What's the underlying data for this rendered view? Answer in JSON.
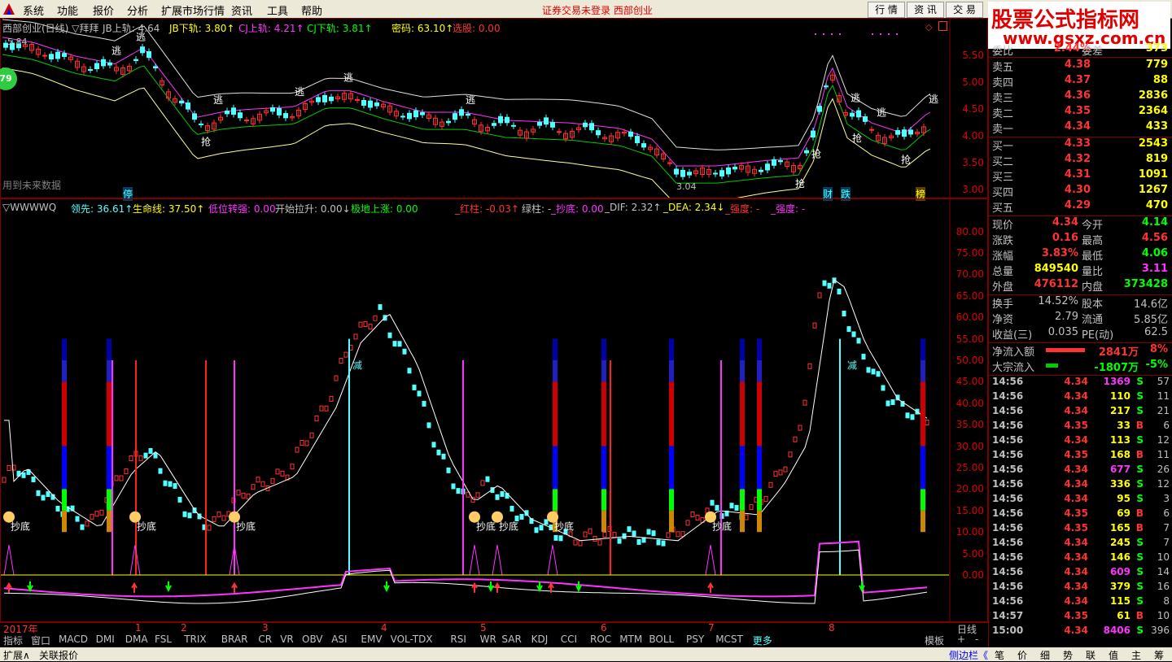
{
  "menu": {
    "items": [
      "系统",
      "功能",
      "报价",
      "分析",
      "扩展市场行情",
      "资讯",
      "工具",
      "帮助"
    ],
    "status": "证券交易未登录  西部创业",
    "buttons": [
      "行 情",
      "资 讯",
      "交 易"
    ]
  },
  "logo": {
    "title": "股票公式指标网",
    "url": "www.gsxz.com.cn"
  },
  "main_chart": {
    "legend": {
      "title": "西部创业(日线) ▽拜拜",
      "jb_up": "JB上轨: 4.64",
      "jb_down": "JB下轨: 3.80↑",
      "cj_up": "CJ上轨: 4.21↑",
      "cj_down": "CJ下轨: 3.81↑",
      "mima": "密码: 63.10↑",
      "xuandu": "选股: 0.00"
    },
    "high_label": "5.84",
    "low_label": "3.04",
    "future_note": "用到未来数据",
    "badge_79": "79",
    "y_ticks": [
      "5.50",
      "5.00",
      "4.50",
      "4.00",
      "3.50",
      "3.00"
    ],
    "markers_escape": "逃",
    "markers_grab": "抢",
    "bottom_marks": [
      "停",
      "财",
      "跌",
      "榜"
    ]
  },
  "sub_chart": {
    "legend": {
      "name": "▽WWWWQ",
      "lingxian": "领先: 36.61↑",
      "shengming": "生命线: 37.50↑",
      "diwei": "低位转强: 0.00",
      "kaishi": "开始拉升: 0.00↓",
      "jidi": "极地上涨: 0.00",
      "hongzhu": "_红柱: -0.03↑",
      "lvzhu": "绿柱: -",
      "chaodi": "_抄底: 0.00",
      "dif": "_DIF: 2.32↑",
      "dea": "_DEA: 2.34↓",
      "qiangdu1": "_强度: -",
      "qiangdu2": "_强度: -"
    },
    "y_ticks": [
      "80.00",
      "75.00",
      "70.00",
      "65.00",
      "60.00",
      "55.00",
      "50.00",
      "45.00",
      "40.00",
      "35.00",
      "30.00",
      "25.00",
      "20.00",
      "15.00",
      "10.00",
      "5.00",
      "0.00"
    ],
    "chaodi_label": "抄底",
    "jian_label": "减"
  },
  "date_axis": {
    "year": "2017年",
    "months": [
      "1",
      "2",
      "3",
      "4",
      "5",
      "6",
      "7",
      "8"
    ],
    "period": "日线"
  },
  "tabs": [
    "指标",
    "窗口",
    "MACD",
    "DMI",
    "DMA",
    "FSL",
    "TRIX",
    "BRAR",
    "CR",
    "VR",
    "OBV",
    "ASI",
    "EMV",
    "VOL-TDX",
    "RSI",
    "WR",
    "SAR",
    "KDJ",
    "CCI",
    "ROC",
    "MTM",
    "BOLL",
    "PSY",
    "MCST",
    "更多"
  ],
  "tab_right": [
    "模板",
    "+",
    "-"
  ],
  "bottom_bar": {
    "left": [
      "扩展∧",
      "关联报价"
    ],
    "right": [
      "侧边栏《",
      "笔",
      "价",
      "细",
      "势",
      "联",
      "值",
      "主",
      "筹"
    ]
  },
  "quote": {
    "top_partial": {
      "name": "委比",
      "value": "2.44%",
      "name2": "委差",
      "value2": "373"
    },
    "sell": [
      {
        "name": "卖五",
        "price": "4.38",
        "vol": "779"
      },
      {
        "name": "卖四",
        "price": "4.37",
        "vol": "88"
      },
      {
        "name": "卖三",
        "price": "4.36",
        "vol": "2836"
      },
      {
        "name": "卖二",
        "price": "4.35",
        "vol": "2364"
      },
      {
        "name": "卖一",
        "price": "4.34",
        "vol": "433"
      }
    ],
    "buy": [
      {
        "name": "买一",
        "price": "4.33",
        "vol": "2543"
      },
      {
        "name": "买二",
        "price": "4.32",
        "vol": "819"
      },
      {
        "name": "买三",
        "price": "4.31",
        "vol": "1091"
      },
      {
        "name": "买四",
        "price": "4.30",
        "vol": "1267"
      },
      {
        "name": "买五",
        "price": "4.29",
        "vol": "470"
      }
    ],
    "stats": [
      {
        "l": "现价",
        "lv": "4.34",
        "r": "今开",
        "rv": "4.14",
        "lc": "#ff3333",
        "rc": "#00ff00"
      },
      {
        "l": "涨跌",
        "lv": "0.16",
        "r": "最高",
        "rv": "4.56",
        "lc": "#ff3333",
        "rc": "#ff3333"
      },
      {
        "l": "涨幅",
        "lv": "3.83%",
        "r": "最低",
        "rv": "4.06",
        "lc": "#ff3333",
        "rc": "#00ff00"
      },
      {
        "l": "总量",
        "lv": "849540",
        "r": "量比",
        "rv": "3.11",
        "lc": "#ffff00",
        "rc": "#ff33ff"
      },
      {
        "l": "外盘",
        "lv": "476112",
        "r": "内盘",
        "rv": "373428",
        "lc": "#ff3333",
        "rc": "#00ff00"
      }
    ],
    "stats2": [
      {
        "l": "换手",
        "lv": "14.52%",
        "r": "股本",
        "rv": "14.6亿"
      },
      {
        "l": "净资",
        "lv": "2.79",
        "r": "流通",
        "rv": "5.85亿"
      },
      {
        "l": "收益(三)",
        "lv": "0.035",
        "r": "PE(动)",
        "rv": "62.5"
      }
    ],
    "flow": [
      {
        "name": "净流入额",
        "bar_fraction": 0.8,
        "bar_color": "#ff3333",
        "value": "2841万",
        "pct": "8%",
        "color": "#ff3333"
      },
      {
        "name": "大宗流入",
        "bar_fraction": 0.25,
        "bar_color": "#00cc00",
        "value": "-1807万",
        "pct": "-5%",
        "color": "#00ff00"
      }
    ],
    "ticks": [
      {
        "t": "14:56",
        "p": "4.34",
        "v": "1369",
        "s": "S",
        "n": "57",
        "pc": "#ff3333",
        "vc": "#ff33ff"
      },
      {
        "t": "14:56",
        "p": "4.34",
        "v": "110",
        "s": "S",
        "n": "11",
        "pc": "#ff3333",
        "vc": "#ffff00"
      },
      {
        "t": "14:56",
        "p": "4.34",
        "v": "217",
        "s": "S",
        "n": "21",
        "pc": "#ff3333",
        "vc": "#ffff00"
      },
      {
        "t": "14:56",
        "p": "4.35",
        "v": "33",
        "s": "B",
        "n": "6",
        "pc": "#ff3333",
        "vc": "#ffff00"
      },
      {
        "t": "14:56",
        "p": "4.34",
        "v": "113",
        "s": "S",
        "n": "12",
        "pc": "#ff3333",
        "vc": "#ffff00"
      },
      {
        "t": "14:56",
        "p": "4.35",
        "v": "168",
        "s": "B",
        "n": "11",
        "pc": "#ff3333",
        "vc": "#ffff00"
      },
      {
        "t": "14:56",
        "p": "4.34",
        "v": "677",
        "s": "S",
        "n": "26",
        "pc": "#ff3333",
        "vc": "#ff33ff"
      },
      {
        "t": "14:56",
        "p": "4.34",
        "v": "336",
        "s": "S",
        "n": "12",
        "pc": "#ff3333",
        "vc": "#ffff00"
      },
      {
        "t": "14:56",
        "p": "4.34",
        "v": "95",
        "s": "S",
        "n": "3",
        "pc": "#ff3333",
        "vc": "#ffff00"
      },
      {
        "t": "14:56",
        "p": "4.35",
        "v": "69",
        "s": "B",
        "n": "6",
        "pc": "#ff3333",
        "vc": "#ffff00"
      },
      {
        "t": "14:56",
        "p": "4.35",
        "v": "165",
        "s": "B",
        "n": "7",
        "pc": "#ff3333",
        "vc": "#ffff00"
      },
      {
        "t": "14:56",
        "p": "4.34",
        "v": "245",
        "s": "S",
        "n": "7",
        "pc": "#ff3333",
        "vc": "#ffff00"
      },
      {
        "t": "14:56",
        "p": "4.34",
        "v": "146",
        "s": "S",
        "n": "10",
        "pc": "#ff3333",
        "vc": "#ffff00"
      },
      {
        "t": "14:56",
        "p": "4.34",
        "v": "609",
        "s": "S",
        "n": "14",
        "pc": "#ff3333",
        "vc": "#ff33ff"
      },
      {
        "t": "14:56",
        "p": "4.34",
        "v": "379",
        "s": "S",
        "n": "16",
        "pc": "#ff3333",
        "vc": "#ffff00"
      },
      {
        "t": "14:56",
        "p": "4.34",
        "v": "115",
        "s": "S",
        "n": "8",
        "pc": "#ff3333",
        "vc": "#ffff00"
      },
      {
        "t": "14:57",
        "p": "4.35",
        "v": "61",
        "s": "B",
        "n": "10",
        "pc": "#ff3333",
        "vc": "#ffff00"
      },
      {
        "t": "15:00",
        "p": "4.34",
        "v": "8406",
        "s": "S",
        "n": "396",
        "pc": "#ff3333",
        "vc": "#ff33ff"
      }
    ]
  },
  "colors": {
    "up": "#ff3333",
    "down": "#54ffff",
    "frame": "#800000",
    "magenta": "#ff33ff",
    "green": "#00ff00",
    "yellow": "#ffff00"
  }
}
